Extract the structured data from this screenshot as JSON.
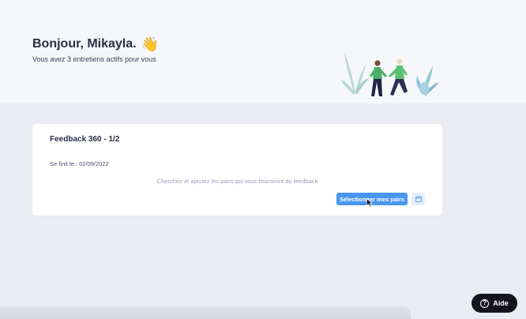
{
  "header": {
    "greeting": "Bonjour, Mikayla.",
    "wave_emoji": "👋",
    "subtitle": "Vous avez 3 entretiens actifs pour vous"
  },
  "card": {
    "title": "Feedback 360 - 1/2",
    "due": "Se finit le : 02/09/2022",
    "hint": "Cherchez et ajoutez les pairs qui vous fourniront du feedback",
    "select_button_label": "Sélectionner mes pairs",
    "calendar_icon": "calendar-icon"
  },
  "help": {
    "label": "Aide",
    "icon_glyph": "?"
  },
  "colors": {
    "accent": "#4a96ee",
    "hero_bg": "#f6f7fa",
    "page_bg": "#eaecf2",
    "help_bg": "#14151c"
  }
}
